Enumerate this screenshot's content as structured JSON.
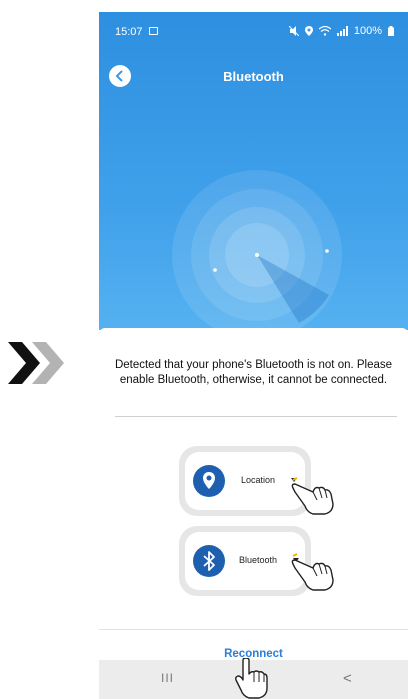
{
  "status_bar": {
    "time": "15:07",
    "battery": "100%"
  },
  "header": {
    "title": "Bluetooth"
  },
  "sheet": {
    "message": "Detected that your phone's Bluetooth is not on. Please enable Bluetooth, otherwise, it cannot be connected.",
    "location_label": "Location",
    "bluetooth_label": "Bluetooth",
    "reconnect_label": "Reconnect"
  },
  "nav": {
    "recents_glyph": "III",
    "back_glyph": "<"
  },
  "colors": {
    "header_blue": "#3a98e6",
    "accent": "#2a7fd8",
    "icon_blue": "#1f5fb0"
  },
  "icons": [
    "double-chevron-icon",
    "gallery-icon",
    "mute-icon",
    "location-status-icon",
    "wifi-icon",
    "signal-icon",
    "battery-icon",
    "back-arrow-icon",
    "radar-icon",
    "location-pin-icon",
    "bluetooth-icon",
    "caret-icon",
    "tap-hand-icon"
  ]
}
